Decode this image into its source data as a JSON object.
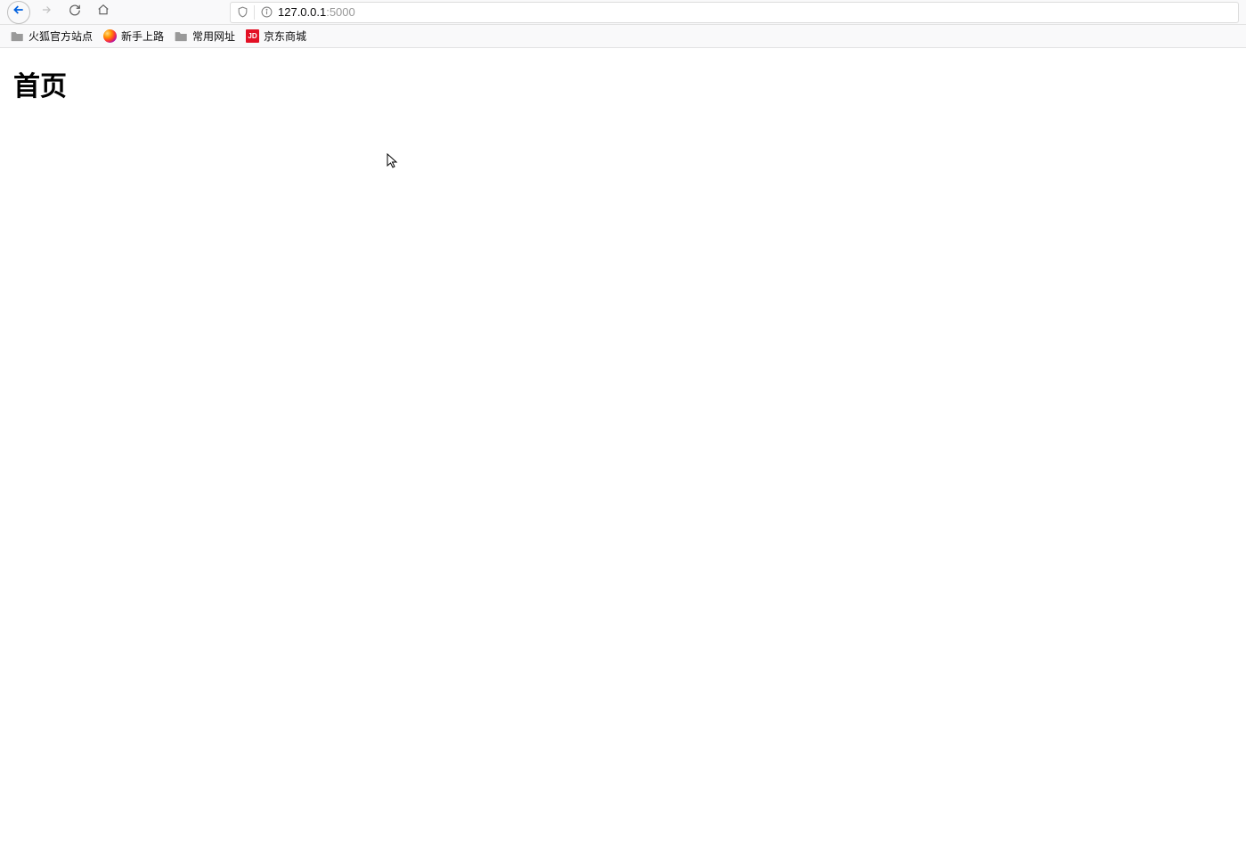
{
  "address": {
    "host": "127.0.0.1",
    "port": ":5000"
  },
  "bookmarks": [
    {
      "label": "火狐官方站点",
      "icon": "folder"
    },
    {
      "label": "新手上路",
      "icon": "firefox"
    },
    {
      "label": "常用网址",
      "icon": "folder"
    },
    {
      "label": "京东商城",
      "icon": "jd",
      "icon_text": "JD"
    }
  ],
  "page": {
    "heading": "首页"
  }
}
